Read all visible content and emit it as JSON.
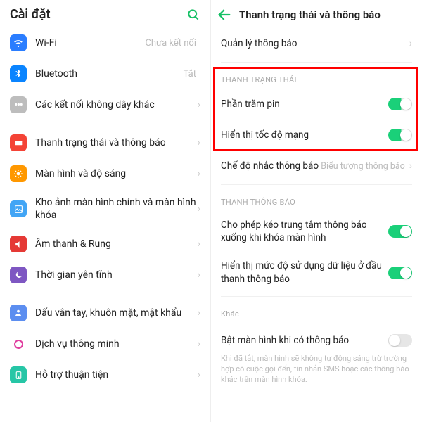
{
  "left": {
    "title": "Cài đặt",
    "items": [
      {
        "key": "wifi",
        "label": "Wi-Fi",
        "value": "Chưa kết nối"
      },
      {
        "key": "bluetooth",
        "label": "Bluetooth",
        "value": "Tắt"
      },
      {
        "key": "wireless",
        "label": "Các kết nối không dây khác",
        "value": ""
      },
      {
        "key": "status",
        "label": "Thanh trạng thái và thông báo",
        "value": ""
      },
      {
        "key": "display",
        "label": "Màn hình và độ sáng",
        "value": ""
      },
      {
        "key": "wallpaper",
        "label": "Kho ảnh màn hình chính và màn hình khóa",
        "value": ""
      },
      {
        "key": "sound",
        "label": "Âm thanh & Rung",
        "value": ""
      },
      {
        "key": "quiet",
        "label": "Thời gian yên tĩnh",
        "value": ""
      },
      {
        "key": "biometric",
        "label": "Dấu vân tay, khuôn mặt, mật khẩu",
        "value": ""
      },
      {
        "key": "smart",
        "label": "Dịch vụ thông minh",
        "value": ""
      },
      {
        "key": "convenience",
        "label": "Hỗ trợ thuận tiện",
        "value": ""
      }
    ]
  },
  "right": {
    "title": "Thanh trạng thái và thông báo",
    "manage": "Quản lý thông báo",
    "group1": "THANH TRẠNG THÁI",
    "battery": "Phần trăm pin",
    "netspeed": "Hiển thị tốc độ mạng",
    "reminder_label": "Chế độ nhắc thông báo",
    "reminder_value": "Biểu tượng thông báo",
    "group2": "THANH THÔNG BÁO",
    "pulldown": "Cho phép kéo trung tâm thông báo xuống khi khóa màn hình",
    "datausage": "Hiển thị mức độ sử dụng dữ liệu ở đầu thanh thông báo",
    "group3": "Khác",
    "wake_label": "Bật màn hình khi có thông báo",
    "wake_desc": "Khi đã tắt, màn hình sẽ không tự động sáng trừ trường hợp có cuộc gọi đến, tin nhắn SMS hoặc các thông báo khác trên màn hình khóa."
  }
}
